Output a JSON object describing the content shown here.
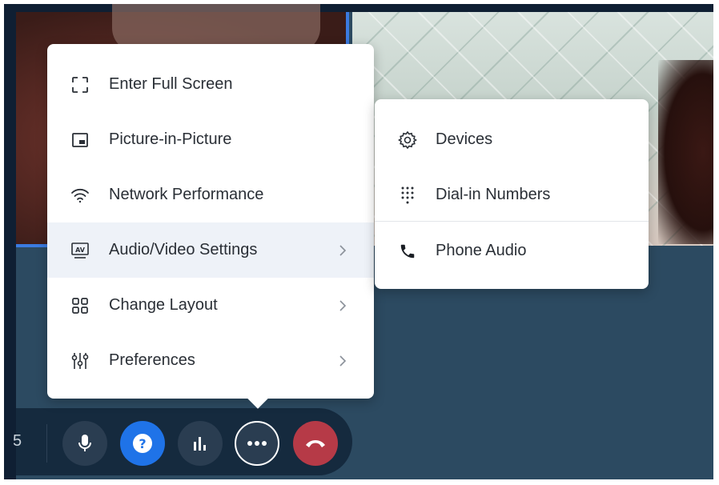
{
  "menu": {
    "items": [
      {
        "label": "Enter Full Screen",
        "icon": "fullscreen-icon"
      },
      {
        "label": "Picture-in-Picture",
        "icon": "picture-in-picture-icon"
      },
      {
        "label": "Network Performance",
        "icon": "wifi-icon"
      },
      {
        "label": "Audio/Video Settings",
        "icon": "av-settings-icon",
        "has_submenu": true,
        "active": true
      },
      {
        "label": "Change Layout",
        "icon": "layout-grid-icon",
        "has_submenu": true
      },
      {
        "label": "Preferences",
        "icon": "sliders-icon",
        "has_submenu": true
      }
    ]
  },
  "submenu": {
    "items": [
      {
        "label": "Devices",
        "icon": "gear-icon"
      },
      {
        "label": "Dial-in Numbers",
        "icon": "dialpad-icon"
      },
      {
        "label": "Phone Audio",
        "icon": "phone-icon"
      }
    ]
  },
  "toolbar": {
    "edge_text": "5",
    "buttons": [
      {
        "name": "microphone",
        "icon": "microphone-icon"
      },
      {
        "name": "help",
        "icon": "help-icon"
      },
      {
        "name": "stats",
        "icon": "bar-chart-icon"
      },
      {
        "name": "more",
        "icon": "more-icon"
      },
      {
        "name": "end-call",
        "icon": "hang-up-icon"
      }
    ]
  },
  "colors": {
    "help_button": "#1f73e8",
    "end_call_button": "#b63a47",
    "active_item_bg": "#eef2f8",
    "stage_bg": "#2c4a61"
  }
}
